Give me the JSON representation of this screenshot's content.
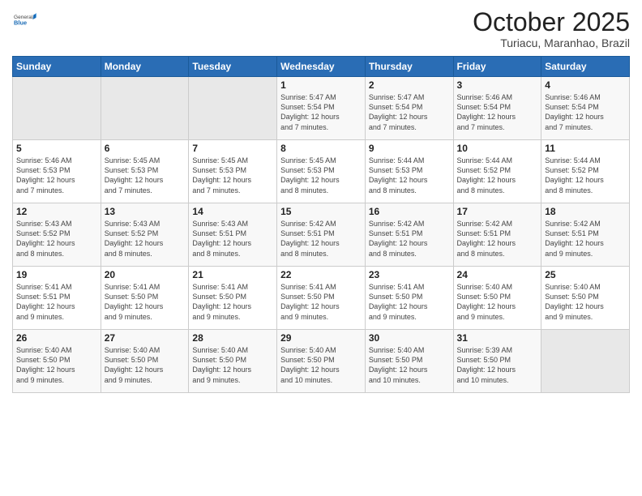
{
  "header": {
    "logo_general": "General",
    "logo_blue": "Blue",
    "month_title": "October 2025",
    "subtitle": "Turiacu, Maranhao, Brazil"
  },
  "days_of_week": [
    "Sunday",
    "Monday",
    "Tuesday",
    "Wednesday",
    "Thursday",
    "Friday",
    "Saturday"
  ],
  "weeks": [
    [
      {
        "day": "",
        "info": ""
      },
      {
        "day": "",
        "info": ""
      },
      {
        "day": "",
        "info": ""
      },
      {
        "day": "1",
        "info": "Sunrise: 5:47 AM\nSunset: 5:54 PM\nDaylight: 12 hours\nand 7 minutes."
      },
      {
        "day": "2",
        "info": "Sunrise: 5:47 AM\nSunset: 5:54 PM\nDaylight: 12 hours\nand 7 minutes."
      },
      {
        "day": "3",
        "info": "Sunrise: 5:46 AM\nSunset: 5:54 PM\nDaylight: 12 hours\nand 7 minutes."
      },
      {
        "day": "4",
        "info": "Sunrise: 5:46 AM\nSunset: 5:54 PM\nDaylight: 12 hours\nand 7 minutes."
      }
    ],
    [
      {
        "day": "5",
        "info": "Sunrise: 5:46 AM\nSunset: 5:53 PM\nDaylight: 12 hours\nand 7 minutes."
      },
      {
        "day": "6",
        "info": "Sunrise: 5:45 AM\nSunset: 5:53 PM\nDaylight: 12 hours\nand 7 minutes."
      },
      {
        "day": "7",
        "info": "Sunrise: 5:45 AM\nSunset: 5:53 PM\nDaylight: 12 hours\nand 7 minutes."
      },
      {
        "day": "8",
        "info": "Sunrise: 5:45 AM\nSunset: 5:53 PM\nDaylight: 12 hours\nand 8 minutes."
      },
      {
        "day": "9",
        "info": "Sunrise: 5:44 AM\nSunset: 5:53 PM\nDaylight: 12 hours\nand 8 minutes."
      },
      {
        "day": "10",
        "info": "Sunrise: 5:44 AM\nSunset: 5:52 PM\nDaylight: 12 hours\nand 8 minutes."
      },
      {
        "day": "11",
        "info": "Sunrise: 5:44 AM\nSunset: 5:52 PM\nDaylight: 12 hours\nand 8 minutes."
      }
    ],
    [
      {
        "day": "12",
        "info": "Sunrise: 5:43 AM\nSunset: 5:52 PM\nDaylight: 12 hours\nand 8 minutes."
      },
      {
        "day": "13",
        "info": "Sunrise: 5:43 AM\nSunset: 5:52 PM\nDaylight: 12 hours\nand 8 minutes."
      },
      {
        "day": "14",
        "info": "Sunrise: 5:43 AM\nSunset: 5:51 PM\nDaylight: 12 hours\nand 8 minutes."
      },
      {
        "day": "15",
        "info": "Sunrise: 5:42 AM\nSunset: 5:51 PM\nDaylight: 12 hours\nand 8 minutes."
      },
      {
        "day": "16",
        "info": "Sunrise: 5:42 AM\nSunset: 5:51 PM\nDaylight: 12 hours\nand 8 minutes."
      },
      {
        "day": "17",
        "info": "Sunrise: 5:42 AM\nSunset: 5:51 PM\nDaylight: 12 hours\nand 8 minutes."
      },
      {
        "day": "18",
        "info": "Sunrise: 5:42 AM\nSunset: 5:51 PM\nDaylight: 12 hours\nand 9 minutes."
      }
    ],
    [
      {
        "day": "19",
        "info": "Sunrise: 5:41 AM\nSunset: 5:51 PM\nDaylight: 12 hours\nand 9 minutes."
      },
      {
        "day": "20",
        "info": "Sunrise: 5:41 AM\nSunset: 5:50 PM\nDaylight: 12 hours\nand 9 minutes."
      },
      {
        "day": "21",
        "info": "Sunrise: 5:41 AM\nSunset: 5:50 PM\nDaylight: 12 hours\nand 9 minutes."
      },
      {
        "day": "22",
        "info": "Sunrise: 5:41 AM\nSunset: 5:50 PM\nDaylight: 12 hours\nand 9 minutes."
      },
      {
        "day": "23",
        "info": "Sunrise: 5:41 AM\nSunset: 5:50 PM\nDaylight: 12 hours\nand 9 minutes."
      },
      {
        "day": "24",
        "info": "Sunrise: 5:40 AM\nSunset: 5:50 PM\nDaylight: 12 hours\nand 9 minutes."
      },
      {
        "day": "25",
        "info": "Sunrise: 5:40 AM\nSunset: 5:50 PM\nDaylight: 12 hours\nand 9 minutes."
      }
    ],
    [
      {
        "day": "26",
        "info": "Sunrise: 5:40 AM\nSunset: 5:50 PM\nDaylight: 12 hours\nand 9 minutes."
      },
      {
        "day": "27",
        "info": "Sunrise: 5:40 AM\nSunset: 5:50 PM\nDaylight: 12 hours\nand 9 minutes."
      },
      {
        "day": "28",
        "info": "Sunrise: 5:40 AM\nSunset: 5:50 PM\nDaylight: 12 hours\nand 9 minutes."
      },
      {
        "day": "29",
        "info": "Sunrise: 5:40 AM\nSunset: 5:50 PM\nDaylight: 12 hours\nand 10 minutes."
      },
      {
        "day": "30",
        "info": "Sunrise: 5:40 AM\nSunset: 5:50 PM\nDaylight: 12 hours\nand 10 minutes."
      },
      {
        "day": "31",
        "info": "Sunrise: 5:39 AM\nSunset: 5:50 PM\nDaylight: 12 hours\nand 10 minutes."
      },
      {
        "day": "",
        "info": ""
      }
    ]
  ]
}
